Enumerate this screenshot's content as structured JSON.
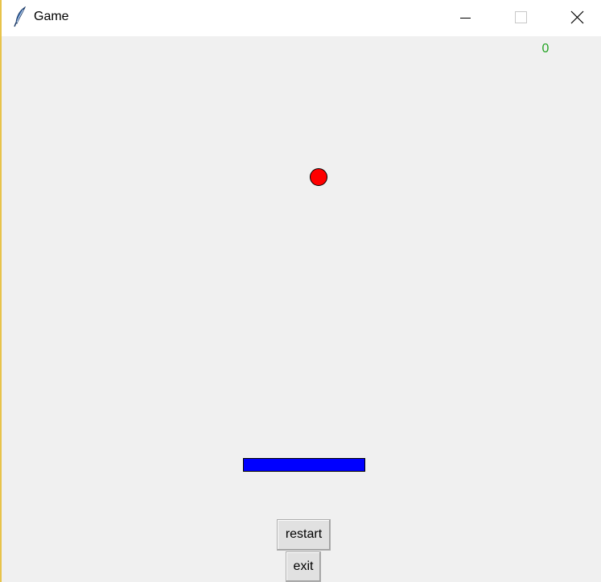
{
  "window": {
    "title": "Game",
    "icon": "feather-icon",
    "controls": [
      "minimize-icon",
      "maximize-icon",
      "close-icon"
    ]
  },
  "game": {
    "score": "0",
    "colors": {
      "score": "#22a322",
      "ball": "#ff0000",
      "paddle": "#0000ff"
    }
  },
  "buttons": {
    "restart_label": "restart",
    "exit_label": "exit"
  }
}
